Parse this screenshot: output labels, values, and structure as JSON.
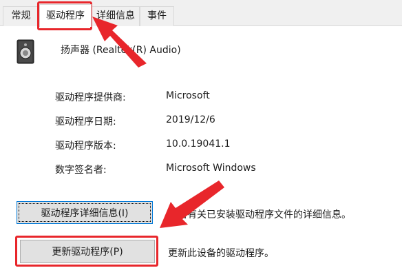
{
  "tabs": [
    {
      "label": "常规"
    },
    {
      "label": "驱动程序"
    },
    {
      "label": "详细信息"
    },
    {
      "label": "事件"
    }
  ],
  "device": {
    "icon": "speaker-icon",
    "name": "扬声器 (Realtek(R) Audio)"
  },
  "properties": [
    {
      "label": "驱动程序提供商:",
      "value": "Microsoft"
    },
    {
      "label": "驱动程序日期:",
      "value": "2019/12/6"
    },
    {
      "label": "驱动程序版本:",
      "value": "10.0.19041.1"
    },
    {
      "label": "数字签名者:",
      "value": "Microsoft Windows"
    }
  ],
  "buttons": {
    "details": {
      "label": "驱动程序详细信息(I)",
      "description": "查看有关已安装驱动程序文件的详细信息。"
    },
    "update": {
      "label": "更新驱动程序(P)",
      "description": "更新此设备的驱动程序。"
    }
  },
  "annotation_color": "#e8262b"
}
